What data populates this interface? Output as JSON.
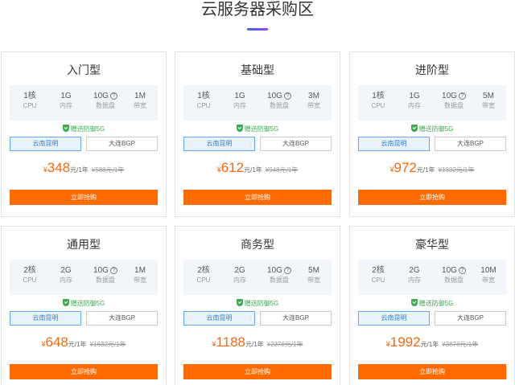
{
  "page": {
    "title": "云服务器采购区"
  },
  "common": {
    "labels": {
      "cpu": "CPU",
      "memory": "内存",
      "disk": "数据盘",
      "bandwidth": "带宽"
    },
    "help_icon_glyph": "?",
    "gift": "赠送防御5G",
    "region_left": "云南昆明",
    "region_right": "大连BGP",
    "currency": "¥",
    "unit": "元/1年",
    "buy_label": "立即抢购"
  },
  "colors": {
    "accent_orange": "#ff6a00",
    "price_orange": "#f26a12",
    "gift_green": "#3caa4e",
    "selected_blue": "#2f7fd2"
  },
  "plans": [
    {
      "name": "入门型",
      "cpu": "1核",
      "memory": "1G",
      "disk": "10G",
      "bandwidth": "1M",
      "price": "348",
      "old_price": "¥588元/1年"
    },
    {
      "name": "基础型",
      "cpu": "1核",
      "memory": "1G",
      "disk": "10G",
      "bandwidth": "3M",
      "price": "612",
      "old_price": "¥948元/1年"
    },
    {
      "name": "进阶型",
      "cpu": "1核",
      "memory": "1G",
      "disk": "10G",
      "bandwidth": "5M",
      "price": "972",
      "old_price": "¥1332元/1年"
    },
    {
      "name": "通用型",
      "cpu": "2核",
      "memory": "2G",
      "disk": "10G",
      "bandwidth": "1M",
      "price": "648",
      "old_price": "¥1632元/1年"
    },
    {
      "name": "商务型",
      "cpu": "2核",
      "memory": "2G",
      "disk": "10G",
      "bandwidth": "5M",
      "price": "1188",
      "old_price": "¥2376元/1年"
    },
    {
      "name": "豪华型",
      "cpu": "2核",
      "memory": "2G",
      "disk": "10G",
      "bandwidth": "10M",
      "price": "1992",
      "old_price": "¥3876元/1年"
    }
  ]
}
